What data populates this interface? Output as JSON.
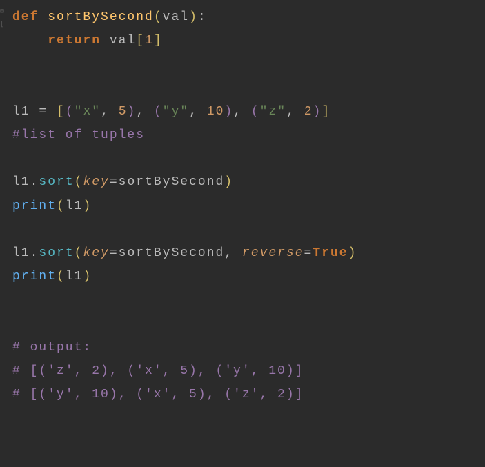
{
  "lines": {
    "l1": {
      "def": "def",
      "space1": " ",
      "fname": "sortBySecond",
      "lparen": "(",
      "param": "val",
      "rparen": ")",
      "colon": ":"
    },
    "l2": {
      "indent": "    ",
      "ret": "return",
      "space": " ",
      "var": "val",
      "lbr": "[",
      "idx": "1",
      "rbr": "]"
    },
    "l5": {
      "var": "l1",
      "sp1": " ",
      "eq": "=",
      "sp2": " ",
      "lb": "[",
      "lp1": "(",
      "s1": "\"x\"",
      "c1": ",",
      "sp3": " ",
      "n1": "5",
      "rp1": ")",
      "c2": ",",
      "sp4": " ",
      "lp2": "(",
      "s2": "\"y\"",
      "c3": ",",
      "sp5": " ",
      "n2": "10",
      "rp2": ")",
      "c4": ",",
      "sp6": " ",
      "lp3": "(",
      "s3": "\"z\"",
      "c5": ",",
      "sp7": " ",
      "n3": "2",
      "rp3": ")",
      "rb": "]"
    },
    "l6": {
      "comment": "#list of tuples"
    },
    "l8": {
      "var": "l1",
      "dot": ".",
      "fn": "sort",
      "lp": "(",
      "kw": "key",
      "eq": "=",
      "val": "sortBySecond",
      "rp": ")"
    },
    "l9": {
      "fn": "print",
      "lp": "(",
      "arg": "l1",
      "rp": ")"
    },
    "l11": {
      "var": "l1",
      "dot": ".",
      "fn": "sort",
      "lp": "(",
      "kw1": "key",
      "eq1": "=",
      "val1": "sortBySecond",
      "c": ",",
      "sp": " ",
      "kw2": "reverse",
      "eq2": "=",
      "val2": "True",
      "rp": ")"
    },
    "l12": {
      "fn": "print",
      "lp": "(",
      "arg": "l1",
      "rp": ")"
    },
    "l15": {
      "comment": "# output:"
    },
    "l16": {
      "comment": "# [('z', 2), ('x', 5), ('y', 10)]"
    },
    "l17": {
      "comment": "# [('y', 10), ('x', 5), ('z', 2)]"
    }
  }
}
